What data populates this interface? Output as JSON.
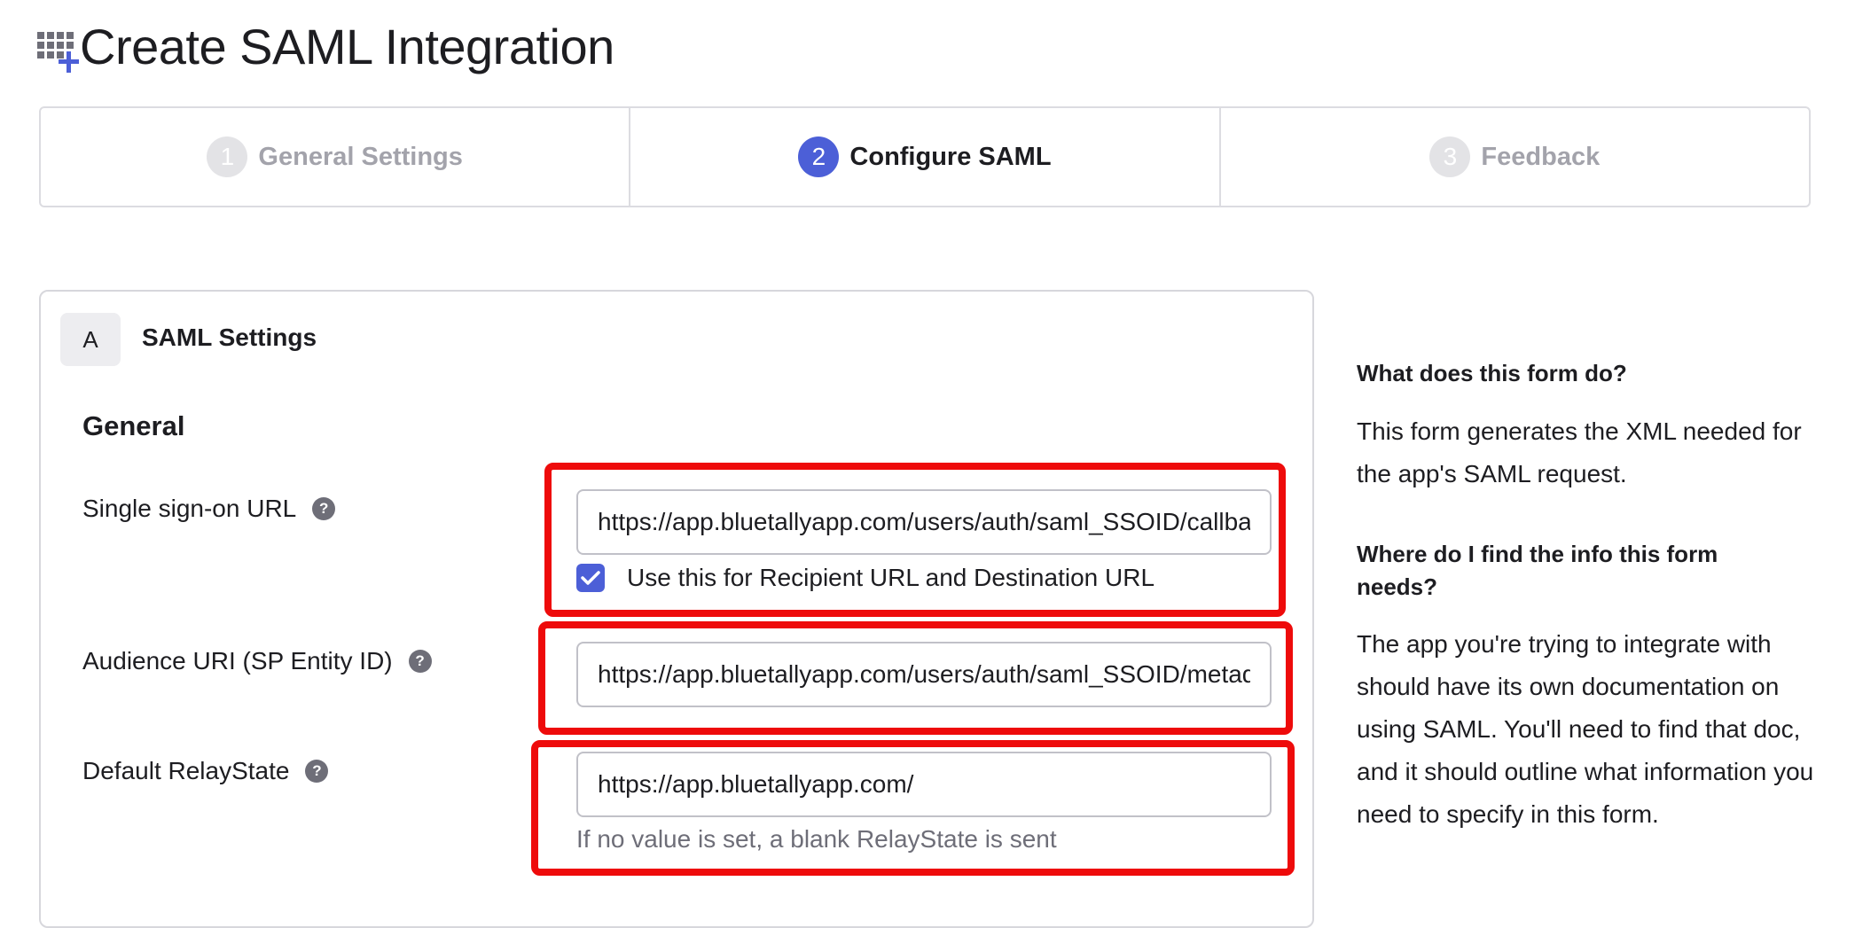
{
  "page": {
    "title": "Create SAML Integration"
  },
  "stepper": [
    {
      "num": "1",
      "label": "General Settings",
      "state": "inactive"
    },
    {
      "num": "2",
      "label": "Configure SAML",
      "state": "active"
    },
    {
      "num": "3",
      "label": "Feedback",
      "state": "inactive"
    }
  ],
  "card": {
    "badge": "A",
    "heading": "SAML Settings",
    "section": "General"
  },
  "fields": {
    "sso_url": {
      "label": "Single sign-on URL",
      "value": "https://app.bluetallyapp.com/users/auth/saml_SSOID/callback",
      "checkbox_label": "Use this for Recipient URL and Destination URL",
      "checked": true
    },
    "audience": {
      "label": "Audience URI (SP Entity ID)",
      "value": "https://app.bluetallyapp.com/users/auth/saml_SSOID/metadata"
    },
    "relay": {
      "label": "Default RelayState",
      "value": "https://app.bluetallyapp.com/",
      "hint": "If no value is set, a blank RelayState is sent"
    },
    "help_glyph": "?"
  },
  "help": {
    "q1": "What does this form do?",
    "a1": "This form generates the XML needed for the app's SAML request.",
    "q2": "Where do I find the info this form needs?",
    "a2": "The app you're trying to integrate with should have its own documentation on using SAML. You'll need to find that doc, and it should outline what information you need to specify in this form."
  },
  "colors": {
    "accent": "#4c5fd7",
    "highlight": "#ee0b0b",
    "inactive_step": "#a3a3ab"
  },
  "icons": {
    "app": "grid-plus-icon",
    "help": "question-circle-icon",
    "check": "checkmark-icon"
  }
}
